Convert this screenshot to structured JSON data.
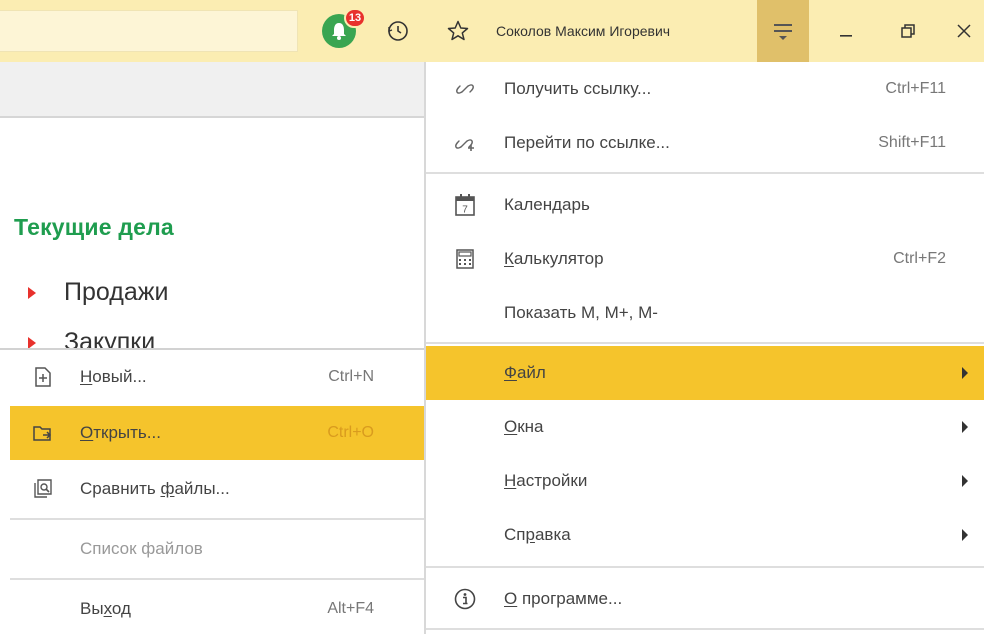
{
  "titlebar": {
    "notifications_count": "13",
    "user_name": "Соколов Максим Игоревич",
    "icons": [
      "bell-icon",
      "history-icon",
      "star-icon",
      "menu-icon",
      "minimize-icon",
      "restore-icon",
      "close-icon"
    ]
  },
  "page": {
    "section_title": "Текущие дела",
    "nav": [
      {
        "label": "Продажи"
      },
      {
        "label": "Закупки"
      }
    ]
  },
  "main_menu": {
    "items": [
      {
        "label": "Получить ссылку...",
        "shortcut": "Ctrl+F11",
        "icon": "link-icon"
      },
      {
        "label": "Перейти по ссылке...",
        "shortcut": "Shift+F11",
        "icon": "follow-link-icon"
      },
      {
        "label": "Календарь",
        "shortcut": "",
        "icon": "calendar-icon",
        "calendar_day": "7"
      },
      {
        "label_u": "К",
        "label_rest": "алькулятор",
        "shortcut": "Ctrl+F2",
        "icon": "calculator-icon"
      },
      {
        "label": "Показать M, M+, M-",
        "shortcut": ""
      },
      {
        "label_u": "Ф",
        "label_rest": "айл",
        "submenu": true,
        "active": true
      },
      {
        "label_u": "О",
        "label_rest": "кна",
        "submenu": true
      },
      {
        "label_u": "Н",
        "label_rest": "астройки",
        "submenu": true
      },
      {
        "label_pre": "Сп",
        "label_u": "р",
        "label_rest": "авка",
        "submenu": true
      },
      {
        "label_u": "О",
        "label_rest": " программе...",
        "icon": "info-icon"
      }
    ]
  },
  "file_submenu": {
    "items": [
      {
        "label_u": "Н",
        "label_rest": "овый...",
        "shortcut": "Ctrl+N",
        "icon": "new-file-icon"
      },
      {
        "label_u": "О",
        "label_rest": "ткрыть...",
        "shortcut": "Ctrl+O",
        "icon": "open-folder-icon",
        "active": true
      },
      {
        "label_pre": "Сравнить ",
        "label_u": "ф",
        "label_rest": "айлы...",
        "shortcut": "",
        "icon": "compare-files-icon"
      },
      {
        "label": "Список файлов",
        "shortcut": "",
        "disabled": true
      },
      {
        "label_pre": "Вы",
        "label_u": "х",
        "label_rest": "од",
        "shortcut": "Alt+F4"
      }
    ]
  },
  "colors": {
    "titlebar_bg": "#fbedb2",
    "highlight": "#f5c42c",
    "menu_button_bg": "#e0c06a",
    "section_title": "#1f9d4f",
    "badge": "#e8312c",
    "bell": "#3aa551"
  }
}
